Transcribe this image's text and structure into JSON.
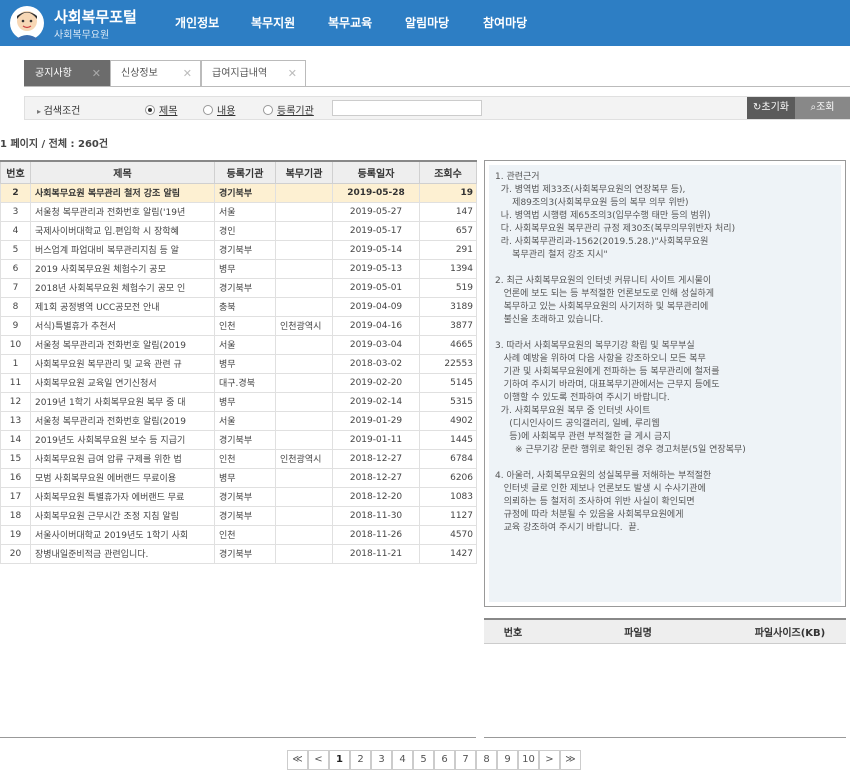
{
  "header": {
    "logo_title": "사회복무포털",
    "logo_sub": "사회복무요원",
    "nav": [
      "개인정보",
      "복무지원",
      "복무교육",
      "알림마당",
      "참여마당"
    ]
  },
  "tabs": [
    {
      "label": "공지사항",
      "active": true
    },
    {
      "label": "신상정보",
      "active": false
    },
    {
      "label": "급여지급내역",
      "active": false
    }
  ],
  "search": {
    "label": "검색조건",
    "options": [
      "제목",
      "내용",
      "등록기관"
    ],
    "selected": "제목",
    "value": "",
    "reset_label": "초기화",
    "search_label": "조회"
  },
  "count_text": "1 페이지 / 전체 : 260건",
  "table": {
    "headers": [
      "번호",
      "제목",
      "등록기관",
      "복무기관",
      "등록일자",
      "조회수"
    ],
    "rows": [
      [
        "2",
        "사회복무요원 복무관리 철저 강조 알림",
        "경기북부",
        "",
        "2019-05-28",
        "19"
      ],
      [
        "3",
        "서울청 복무관리과 전화번호 알림('19년",
        "서울",
        "",
        "2019-05-27",
        "147"
      ],
      [
        "4",
        "국제사이버대학교 입.편입학 시 장학혜",
        "경인",
        "",
        "2019-05-17",
        "657"
      ],
      [
        "5",
        "버스업계 파업대비 복무관리지침 등 알",
        "경기북부",
        "",
        "2019-05-14",
        "291"
      ],
      [
        "6",
        "2019 사회복무요원 체험수기 공모",
        "병무",
        "",
        "2019-05-13",
        "1394"
      ],
      [
        "7",
        "2018년 사회복무요원 체험수기 공모 인",
        "경기북부",
        "",
        "2019-05-01",
        "519"
      ],
      [
        "8",
        "제1회 공정병역 UCC공모전 안내",
        "충북",
        "",
        "2019-04-09",
        "3189"
      ],
      [
        "9",
        "서식)특별휴가 추천서",
        "인천",
        "인천광역시",
        "2019-04-16",
        "3877"
      ],
      [
        "10",
        "서울청 복무관리과 전화번호 알림(2019",
        "서울",
        "",
        "2019-03-04",
        "4665"
      ],
      [
        "1",
        "사회복무요원 복무관리 및 교육 관련 규",
        "병무",
        "",
        "2018-03-02",
        "22553"
      ],
      [
        "11",
        "사회복무요원 교육일 연기신청서",
        "대구.경북",
        "",
        "2019-02-20",
        "5145"
      ],
      [
        "12",
        "2019년 1학기 사회복무요원 복무 중 대",
        "병무",
        "",
        "2019-02-14",
        "5315"
      ],
      [
        "13",
        "서울청 복무관리과 전화번호 알림(2019",
        "서울",
        "",
        "2019-01-29",
        "4902"
      ],
      [
        "14",
        "2019년도 사회복무요원 보수 등 지급기",
        "경기북부",
        "",
        "2019-01-11",
        "1445"
      ],
      [
        "15",
        "사회복무요원 급여 압류 구제를 위한 법",
        "인천",
        "인천광역시",
        "2018-12-27",
        "6784"
      ],
      [
        "16",
        "모범 사회복무요원 에버랜드 무료이용",
        "병무",
        "",
        "2018-12-27",
        "6206"
      ],
      [
        "17",
        "사회복무요원 특별휴가자 에버랜드 무료",
        "경기북부",
        "",
        "2018-12-20",
        "1083"
      ],
      [
        "18",
        "사회복무요원 근무시간 조정 지침 알림",
        "경기북부",
        "",
        "2018-11-30",
        "1127"
      ],
      [
        "19",
        "서울사이버대학교 2019년도 1학기 사회",
        "인천",
        "",
        "2018-11-26",
        "4570"
      ],
      [
        "20",
        "장병내일준비적금 관련입니다.",
        "경기북부",
        "",
        "2018-11-21",
        "1427"
      ]
    ]
  },
  "detail": [
    "1. 관련근거",
    "  가. 병역법 제33조(사회복무요원의 연장복무 등),",
    "      제89조의3(사회복무요원 등의 복무 의무 위반)",
    "  나. 병역법 시행령 제65조의3(입무수행 태만 등의 범위)",
    "  다. 사회복무요원 복무관리 규정 제30조(복무의무위반자 처리)",
    "  라. 사회복무관리과-1562(2019.5.28.)\"사회복무요원",
    "      복무관리 철저 강조 지시\"",
    "",
    "2. 최근 사회복무요원의 인터넷 커뮤니티 사이트 게시물이",
    "   언론에 보도 되는 등 부적절한 언론보도로 인해 성실하게",
    "   복무하고 있는 사회복무요원의 사기저하 및 복무관리에",
    "   불신을 초래하고 있습니다.",
    "",
    "3. 따라서 사회복무요원의 복무기강 확립 및 복무부실",
    "   사례 예방을 위하여 다음 사항을 강조하오니 모든 복무",
    "   기관 및 사회복무요원에게 전파하는 등 복무관리에 철저를",
    "   기하여 주시기 바라며, 대표복무기관에서는 근무지 등에도",
    "   이행할 수 있도록 전파하여 주시기 바랍니다.",
    "  가. 사회복무요원 복무 중 인터넷 사이트",
    "     (디시인사이드 공익갤러리, 일베, 루리웹",
    "     등)에 사회복무 관련 부적절한 글 게시 금지",
    "       ※ 근무기강 문란 행위로 확인된 경우 경고처분(5일 연장복무)",
    "",
    "4. 아울러, 사회복무요원의 성실복무를 저해하는 부적절한",
    "   인터넷 글로 인한 제보나 언론보도 발생 시 수사기관에",
    "   의뢰하는 등 철저히 조사하여 위반 사실이 확인되면",
    "   규정에 따라 처분될 수 있음을 사회복무요원에게",
    "   교육 강조하여 주시기 바랍니다.  끝."
  ],
  "files": {
    "headers": [
      "번호",
      "파일명",
      "파일사이즈(KB)"
    ]
  },
  "pager": {
    "first": "≪",
    "prev": "<",
    "pages": [
      "1",
      "2",
      "3",
      "4",
      "5",
      "6",
      "7",
      "8",
      "9",
      "10"
    ],
    "current": "1",
    "next": ">",
    "last": "≫"
  },
  "colors": {
    "header_bg": "#2d7ec4",
    "selected_row": "#fdf0d2",
    "detail_bg": "#eef3f7"
  }
}
